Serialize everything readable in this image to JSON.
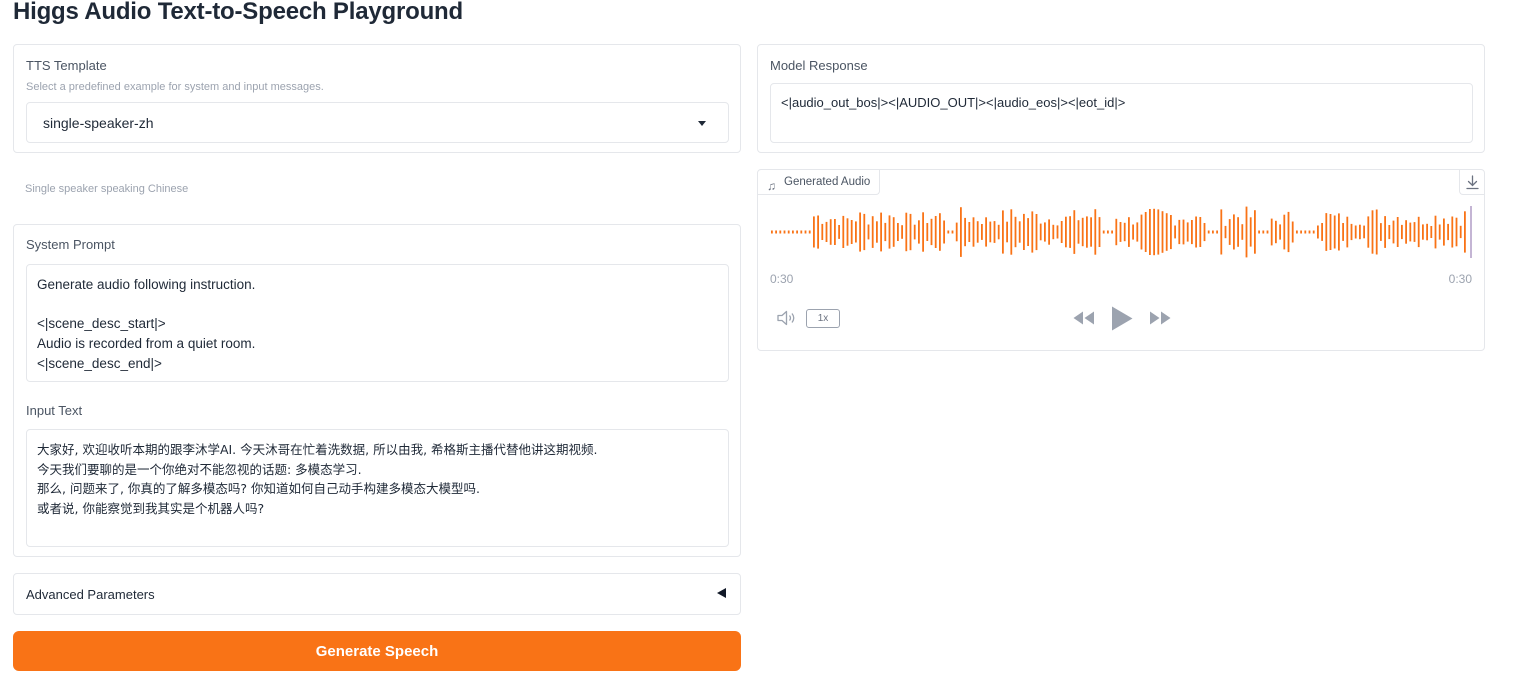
{
  "page": {
    "title": "Higgs Audio Text-to-Speech Playground"
  },
  "template": {
    "label": "TTS Template",
    "info": "Select a predefined example for system and input messages.",
    "selected": "single-speaker-zh"
  },
  "description": "Single speaker speaking Chinese",
  "system_prompt": {
    "label": "System Prompt",
    "value": "Generate audio following instruction.\n\n<|scene_desc_start|>\nAudio is recorded from a quiet room.\n<|scene_desc_end|>"
  },
  "input_text": {
    "label": "Input Text",
    "value": "大家好, 欢迎收听本期的跟李沐学AI. 今天沐哥在忙着洗数据, 所以由我, 希格斯主播代替他讲这期视频.\n今天我们要聊的是一个你绝对不能忽视的话题: 多模态学习.\n那么, 问题来了, 你真的了解多模态吗? 你知道如何自己动手构建多模态大模型吗.\n或者说, 你能察觉到我其实是个机器人吗?"
  },
  "advanced": {
    "label": "Advanced Parameters"
  },
  "generate_button": {
    "label": "Generate Speech"
  },
  "model_response": {
    "label": "Model Response",
    "value": "<|audio_out_bos|><|AUDIO_OUT|><|audio_eos|><|eot_id|>"
  },
  "audio": {
    "label": "Generated Audio",
    "time_current": "0:30",
    "time_total": "0:30",
    "speed": "1x",
    "waveform_color": "#f97316",
    "icons": {
      "note": "music-note-icon",
      "download": "download-icon",
      "volume": "volume-icon",
      "rewind": "rewind-icon",
      "play": "play-icon",
      "forward": "fast-forward-icon"
    }
  },
  "colors": {
    "accent": "#f97316",
    "border": "#e5e7eb",
    "muted": "#9ca3af"
  }
}
